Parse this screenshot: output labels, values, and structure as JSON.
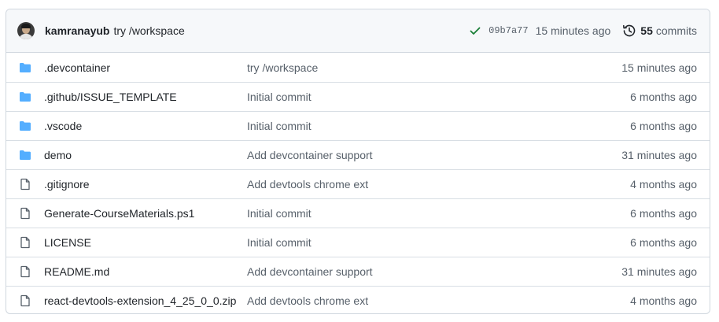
{
  "header": {
    "author": "kamranayub",
    "message": "try /workspace",
    "sha": "09b7a77",
    "time": "15 minutes ago",
    "commit_count": "55",
    "commits_label": "commits",
    "status_icon": "check-icon",
    "history_icon": "history-icon",
    "check_color": "#1a7f37"
  },
  "colors": {
    "folder": "#54aeff",
    "file": "#57606a",
    "border": "#d0d7de"
  },
  "files": [
    {
      "type": "folder",
      "name": ".devcontainer",
      "message": "try /workspace",
      "age": "15 minutes ago"
    },
    {
      "type": "folder",
      "name": ".github/ISSUE_TEMPLATE",
      "message": "Initial commit",
      "age": "6 months ago"
    },
    {
      "type": "folder",
      "name": ".vscode",
      "message": "Initial commit",
      "age": "6 months ago"
    },
    {
      "type": "folder",
      "name": "demo",
      "message": "Add devcontainer support",
      "age": "31 minutes ago"
    },
    {
      "type": "file",
      "name": ".gitignore",
      "message": "Add devtools chrome ext",
      "age": "4 months ago"
    },
    {
      "type": "file",
      "name": "Generate-CourseMaterials.ps1",
      "message": "Initial commit",
      "age": "6 months ago"
    },
    {
      "type": "file",
      "name": "LICENSE",
      "message": "Initial commit",
      "age": "6 months ago"
    },
    {
      "type": "file",
      "name": "README.md",
      "message": "Add devcontainer support",
      "age": "31 minutes ago"
    },
    {
      "type": "file",
      "name": "react-devtools-extension_4_25_0_0.zip",
      "message": "Add devtools chrome ext",
      "age": "4 months ago"
    }
  ]
}
